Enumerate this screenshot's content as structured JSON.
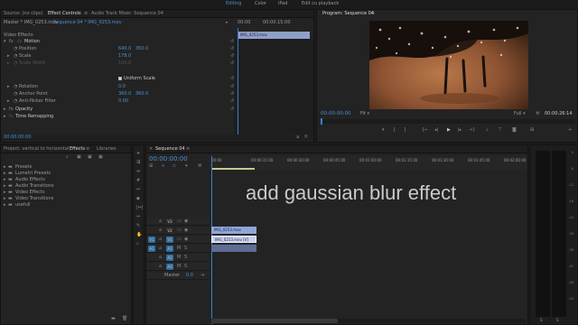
{
  "header": {
    "tabs": [
      "Editing",
      "Color",
      "iPad",
      "Edit cu playback"
    ],
    "active_tab": "Editing"
  },
  "effect_controls": {
    "tabs": [
      "Source: (no clips)",
      "Effect Controls",
      "Audio Track Mixer: Sequence 04"
    ],
    "clip_left": "Master * IMG_0253.mov",
    "clip_right": "Sequence 04 * IMG_0253.mov",
    "timecode_start": "00:00",
    "timecode_end": "00:00:15:00",
    "clip_bar_label": "IMG_0253.mov",
    "section": "Video Effects",
    "motion_label": "Motion",
    "props": [
      {
        "name": "Position",
        "value": "640.0",
        "value2": "360.0"
      },
      {
        "name": "Scale",
        "value": "178.0",
        "value2": ""
      },
      {
        "name": "Scale Width",
        "value": "100.0",
        "value2": ""
      },
      {
        "name": "Rotation",
        "value": "0.0",
        "value2": ""
      },
      {
        "name": "Anchor Point",
        "value": "360.0",
        "value2": "360.0"
      },
      {
        "name": "Anti-flicker Filter",
        "value": "0.00",
        "value2": ""
      }
    ],
    "uniform_scale": "Uniform Scale",
    "opacity": "Opacity",
    "time_remap": "Time Remapping",
    "footer_timecode": "00:00:00:00"
  },
  "program": {
    "title": "Program: Sequence 04",
    "timecode": "00:00:00:00",
    "fit": "Fit",
    "quality": "Full",
    "duration": "00:00:26:14"
  },
  "project": {
    "tabs": [
      "Project: vertical to horizontal",
      "Effects",
      "Libraries"
    ],
    "items": [
      "Presets",
      "Lumetri Presets",
      "Audio Effects",
      "Audio Transitions",
      "Video Effects",
      "Video Transitions",
      "usefull"
    ]
  },
  "timeline": {
    "title": "Sequence 04",
    "timecode": "00:00:00:00",
    "ruler": [
      "00:00",
      "00:00:15:00",
      "00:00:30:00",
      "00:00:45:00",
      "00:01:00:00",
      "00:01:15:00",
      "00:01:30:00",
      "00:01:45:00",
      "00:02:00:00"
    ],
    "tracks": [
      "V3",
      "V2",
      "V1",
      "A1",
      "A2",
      "A3"
    ],
    "source_v": "V1",
    "source_a": "A1",
    "master": "Master",
    "master_val": "0.0",
    "clip_v2": "IMG_0253.mov",
    "clip_v1": "IMG_0253.mov [V]",
    "overlay": "add gaussian blur effect"
  },
  "meter": {
    "ticks": [
      "0",
      "-6",
      "-12",
      "-18",
      "-24",
      "-30",
      "-36",
      "-42",
      "-48",
      "-54"
    ],
    "bottom": [
      "S",
      "S"
    ]
  }
}
